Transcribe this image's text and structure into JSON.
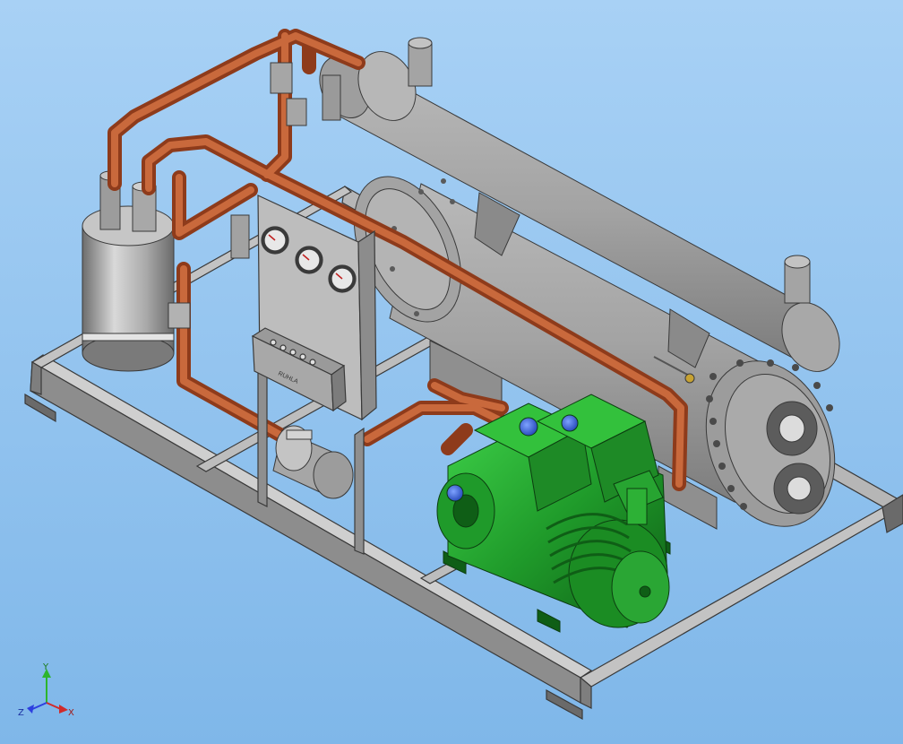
{
  "viewport": {
    "background_top": "#a8d1f5",
    "background_bottom": "#7fb7e9"
  },
  "panel": {
    "nameplate_text": "RUHLA",
    "gauge_count": 3
  },
  "triad": {
    "y_label": "Y",
    "z_label": "Z",
    "x_label": "X",
    "y_color": "#2db52d",
    "z_color": "#2d3fe0",
    "x_color": "#d02a2a"
  },
  "colors": {
    "frame_steel": "#9a9a9a",
    "frame_edge": "#3a3a3a",
    "vessel_gray": "#a9a9a9",
    "copper_pipe": "#b4532a",
    "compressor_green": "#1f9a2a",
    "motor_blue": "#2a5bd0"
  }
}
